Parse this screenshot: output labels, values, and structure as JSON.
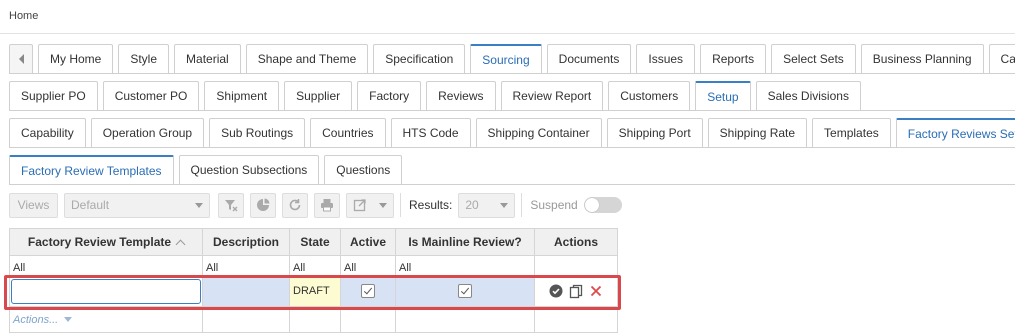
{
  "breadcrumb": "Home",
  "tabs_row1": [
    "My Home",
    "Style",
    "Material",
    "Shape and Theme",
    "Specification",
    "Sourcing",
    "Documents",
    "Issues",
    "Reports",
    "Select Sets",
    "Business Planning",
    "Calendar"
  ],
  "tabs_row2": [
    "Supplier PO",
    "Customer PO",
    "Shipment",
    "Supplier",
    "Factory",
    "Reviews",
    "Review Report",
    "Customers",
    "Setup",
    "Sales Divisions"
  ],
  "tabs_row3": [
    "Capability",
    "Operation Group",
    "Sub Routings",
    "Countries",
    "HTS Code",
    "Shipping Container",
    "Shipping Port",
    "Shipping Rate",
    "Templates",
    "Factory Reviews Setup"
  ],
  "tabs_row4": [
    "Factory Review Templates",
    "Question Subsections",
    "Questions"
  ],
  "toolbar": {
    "views_label": "Views",
    "view_value": "Default",
    "results_label": "Results:",
    "results_value": "20",
    "suspend_label": "Suspend"
  },
  "grid": {
    "columns": [
      "Factory Review Template",
      "Description",
      "State",
      "Active",
      "Is Mainline Review?",
      "Actions"
    ],
    "filters": [
      "All",
      "All",
      "All",
      "All",
      "All",
      ""
    ],
    "edit_row": {
      "state": "DRAFT",
      "active": true,
      "mainline": true
    },
    "actions_label": "Actions..."
  },
  "colors": {
    "accent": "#3a7fc4",
    "highlight": "#d9484b",
    "delete": "#e04848"
  }
}
